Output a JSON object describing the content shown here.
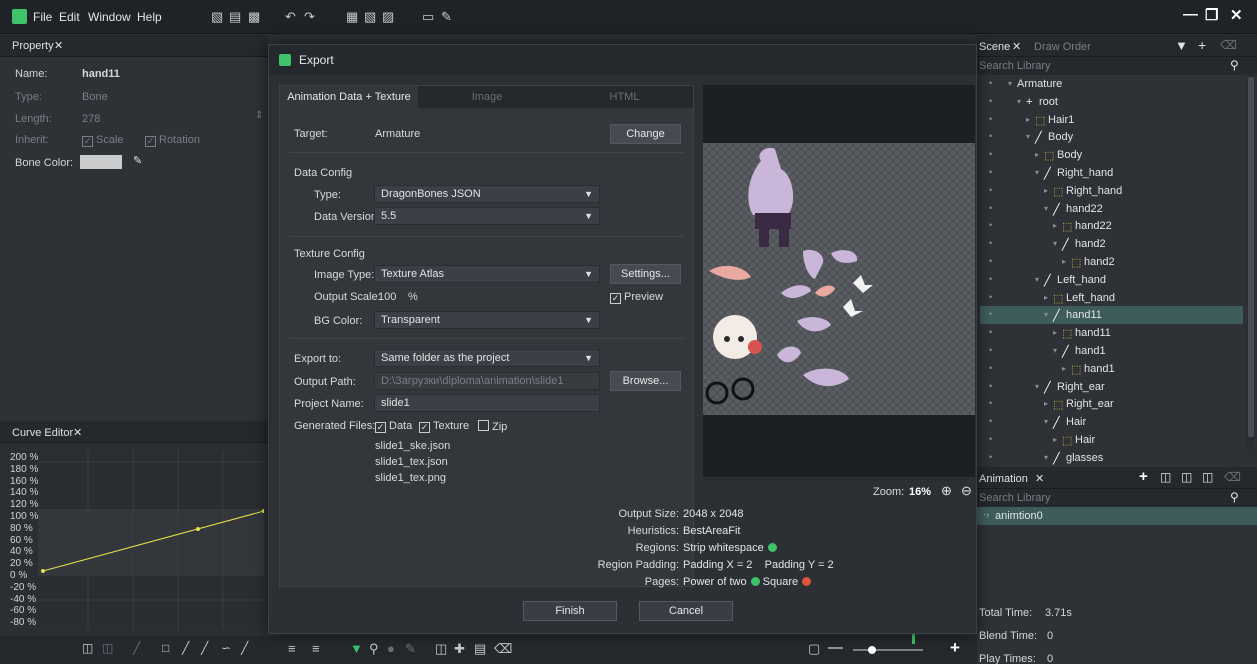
{
  "menubar": {
    "items": [
      "File",
      "Edit",
      "Window",
      "Help"
    ]
  },
  "property": {
    "tab": "Property",
    "name_label": "Name:",
    "name_value": "hand11",
    "type_label": "Type:",
    "type_value": "Bone",
    "length_label": "Length:",
    "length_value": "278",
    "inherit_label": "Inherit:",
    "inherit_scale": "Scale",
    "inherit_rotation": "Rotation",
    "bone_color_label": "Bone Color:"
  },
  "curve_editor": {
    "tab": "Curve Editor",
    "ticks": [
      "200 %",
      "180 %",
      "160 %",
      "140 %",
      "120 %",
      "100 %",
      "80 %",
      "60 %",
      "40 %",
      "20 %",
      "0 %",
      "-20 %",
      "-40 %",
      "-60 %",
      "-80 %"
    ]
  },
  "dialog": {
    "title": "Export",
    "tabs": [
      "Animation Data + Texture",
      "Image",
      "HTML"
    ],
    "target_label": "Target:",
    "target_value": "Armature",
    "change_btn": "Change",
    "data_config": "Data Config",
    "type_label": "Type:",
    "type_value": "DragonBones JSON",
    "version_label": "Data Version:",
    "version_value": "5.5",
    "texture_config": "Texture Config",
    "image_type_label": "Image Type:",
    "image_type_value": "Texture Atlas",
    "settings_btn": "Settings...",
    "output_scale_label": "Output Scale:",
    "output_scale_value": "100",
    "output_scale_unit": "%",
    "preview_label": "Preview",
    "bg_color_label": "BG Color:",
    "bg_color_value": "Transparent",
    "export_to_label": "Export to:",
    "export_to_value": "Same folder as the project",
    "output_path_label": "Output Path:",
    "output_path_value": "D:\\Загрузки\\diploma\\animation\\slide1",
    "browse_btn": "Browse...",
    "project_name_label": "Project Name:",
    "project_name_value": "slide1",
    "generated_label": "Generated Files:",
    "gen_data": "Data",
    "gen_texture": "Texture",
    "gen_zip": "Zip",
    "files": [
      "slide1_ske.json",
      "slide1_tex.json",
      "slide1_tex.png"
    ],
    "zoom_label": "Zoom:",
    "zoom_value": "16%",
    "info": {
      "output_size_k": "Output Size:",
      "output_size_v": "2048 x 2048",
      "heuristics_k": "Heuristics:",
      "heuristics_v": "BestAreaFit",
      "regions_k": "Regions:",
      "regions_v": "Strip whitespace",
      "padding_k": "Region Padding:",
      "padding_v": "Padding X = 2    Padding Y = 2",
      "pages_k": "Pages:",
      "pages_v1": "Power of two",
      "pages_v2": "Square"
    },
    "finish_btn": "Finish",
    "cancel_btn": "Cancel"
  },
  "scene": {
    "tab": "Scene",
    "tab2": "Draw Order",
    "search": "Search Library",
    "tree": [
      {
        "label": "Armature",
        "indent": 0,
        "icon": "",
        "selected": false
      },
      {
        "label": "root",
        "indent": 1,
        "icon": "+",
        "selected": false
      },
      {
        "label": "Hair1",
        "indent": 2,
        "icon": "img",
        "selected": false
      },
      {
        "label": "Body",
        "indent": 2,
        "icon": "bone",
        "selected": false
      },
      {
        "label": "Body",
        "indent": 3,
        "icon": "img",
        "selected": false
      },
      {
        "label": "Right_hand",
        "indent": 3,
        "icon": "bone",
        "selected": false
      },
      {
        "label": "Right_hand",
        "indent": 4,
        "icon": "img",
        "selected": false
      },
      {
        "label": "hand22",
        "indent": 4,
        "icon": "bone",
        "selected": false
      },
      {
        "label": "hand22",
        "indent": 5,
        "icon": "img",
        "selected": false
      },
      {
        "label": "hand2",
        "indent": 5,
        "icon": "bone",
        "selected": false
      },
      {
        "label": "hand2",
        "indent": 6,
        "icon": "img",
        "selected": false
      },
      {
        "label": "Left_hand",
        "indent": 3,
        "icon": "bone",
        "selected": false
      },
      {
        "label": "Left_hand",
        "indent": 4,
        "icon": "img",
        "selected": false
      },
      {
        "label": "hand11",
        "indent": 4,
        "icon": "bone",
        "selected": true
      },
      {
        "label": "hand11",
        "indent": 5,
        "icon": "img",
        "selected": false
      },
      {
        "label": "hand1",
        "indent": 5,
        "icon": "bone",
        "selected": false
      },
      {
        "label": "hand1",
        "indent": 6,
        "icon": "img",
        "selected": false
      },
      {
        "label": "Right_ear",
        "indent": 3,
        "icon": "bone",
        "selected": false
      },
      {
        "label": "Right_ear",
        "indent": 4,
        "icon": "img",
        "selected": false
      },
      {
        "label": "Hair",
        "indent": 4,
        "icon": "bone",
        "selected": false
      },
      {
        "label": "Hair",
        "indent": 5,
        "icon": "img",
        "selected": false
      },
      {
        "label": "glasses",
        "indent": 4,
        "icon": "bone",
        "selected": false
      }
    ]
  },
  "animation": {
    "tab": "Animation",
    "search": "Search Library",
    "item": "animtion0",
    "total_time_label": "Total Time:",
    "total_time_value": "3.71s",
    "blend_time_label": "Blend Time:",
    "blend_time_value": "0",
    "play_times_label": "Play Times:",
    "play_times_value": "0"
  },
  "colors": {
    "accent": "#3ec26a",
    "selected_row": "#3f5c5c",
    "curve": "#e6e24a"
  }
}
